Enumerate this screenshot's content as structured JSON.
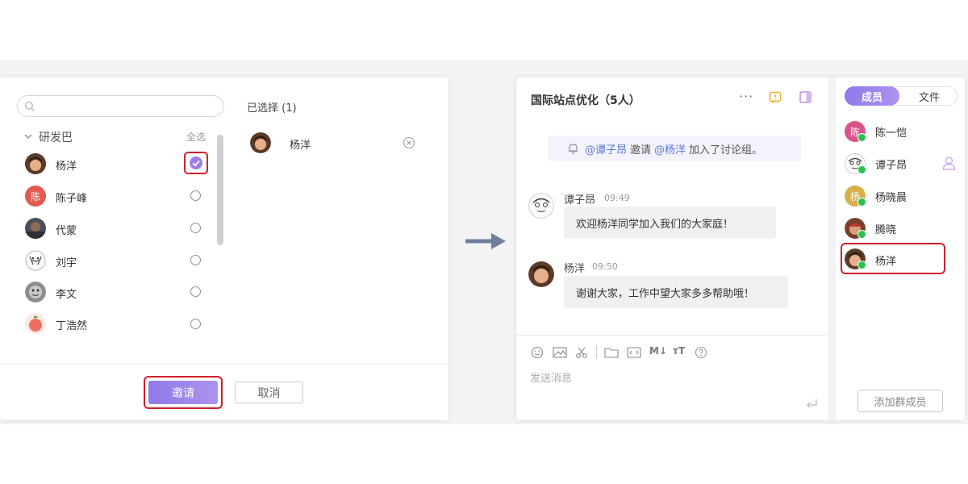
{
  "invite_dialog": {
    "search": {
      "placeholder": ""
    },
    "group_name": "研发巴",
    "select_all": "全选",
    "members": [
      {
        "name": "杨洋",
        "checked": true
      },
      {
        "name": "陈子峰",
        "avatar_text": "陈",
        "avatar_color": "#e05a4f",
        "checked": false
      },
      {
        "name": "代蒙",
        "checked": false
      },
      {
        "name": "刘宇",
        "checked": false
      },
      {
        "name": "李文",
        "checked": false
      },
      {
        "name": "丁浩然",
        "checked": false
      }
    ],
    "selected_title": "已选择 (1)",
    "selected": [
      {
        "name": "杨洋"
      }
    ],
    "invite_label": "邀请",
    "cancel_label": "取消"
  },
  "chat": {
    "title": "国际站点优化（5人）",
    "system_notice": {
      "mention1": "@谭子昂",
      "verb": "邀请",
      "mention2": "@杨洋",
      "rest": "加入了讨论组。"
    },
    "messages": [
      {
        "sender": "谭子昂",
        "time": "09:49",
        "text": "欢迎杨洋同学加入我们的大家庭！"
      },
      {
        "sender": "杨洋",
        "time": "09:50",
        "text": "谢谢大家，工作中望大家多多帮助哦！"
      }
    ],
    "input_placeholder": "发送消息",
    "toolbar_icons": [
      "emoji-icon",
      "image-icon",
      "scissors-icon",
      "folder-icon",
      "code-icon",
      "markdown-icon",
      "text-format-icon",
      "help-icon"
    ],
    "accent": "#9b7ee6"
  },
  "members_panel": {
    "tabs": [
      {
        "label": "成员",
        "active": true
      },
      {
        "label": "文件",
        "active": false
      }
    ],
    "list": [
      {
        "name": "陈一恺",
        "avatar_text": "陈",
        "avatar_color": "#d9548a",
        "online": true
      },
      {
        "name": "谭子昂",
        "online": true
      },
      {
        "name": "杨晓晨",
        "avatar_text": "杨",
        "avatar_color": "#d8b04a",
        "online": true
      },
      {
        "name": "腾晓",
        "online": true
      },
      {
        "name": "杨洋",
        "online": true
      }
    ],
    "add_member_label": "添加群成员"
  }
}
